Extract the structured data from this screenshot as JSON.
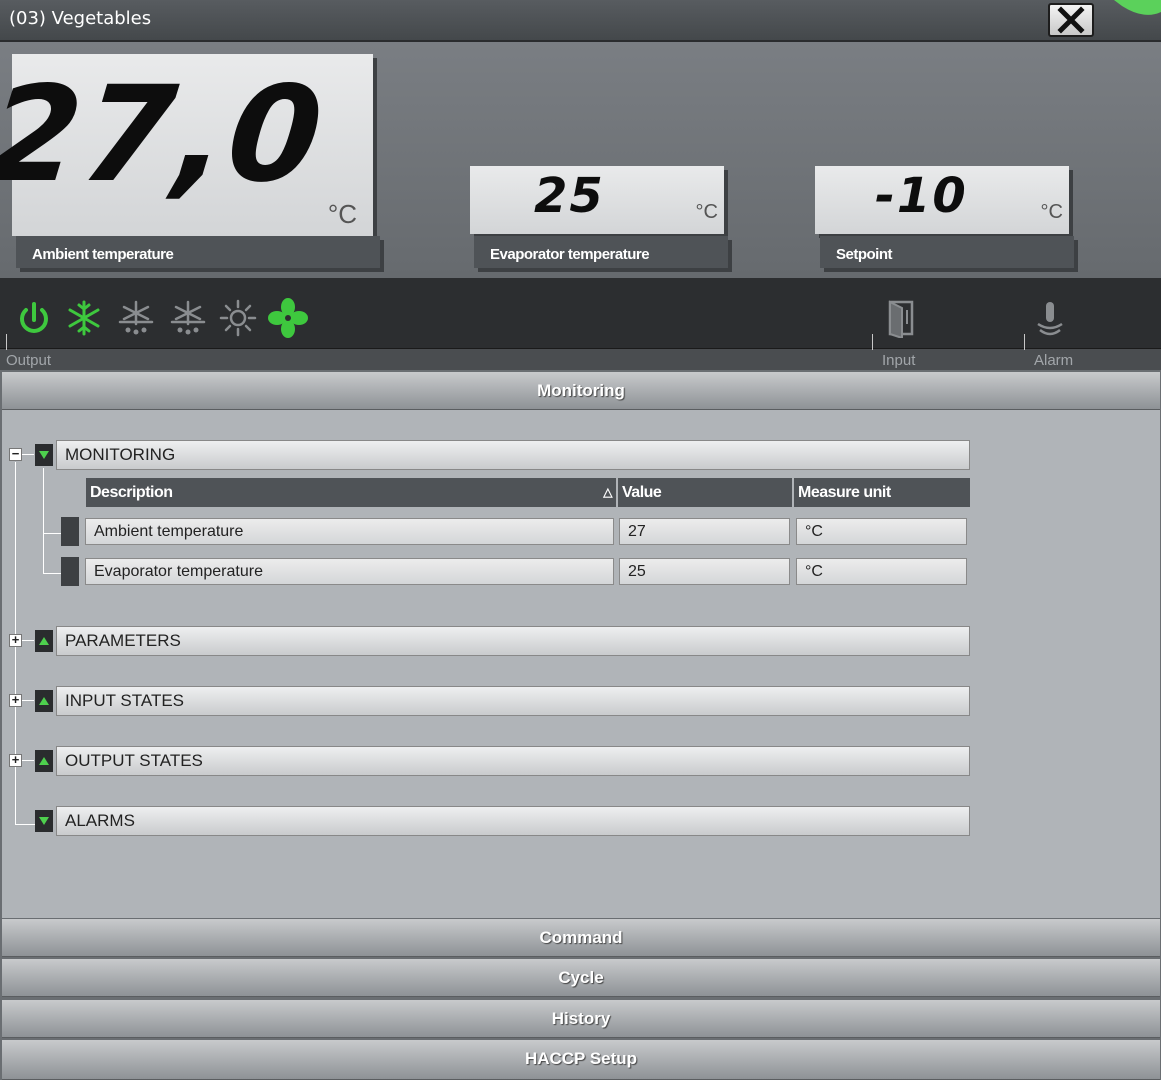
{
  "window": {
    "title": "(03) Vegetables",
    "close_icon": "close-icon"
  },
  "displays": {
    "ambient": {
      "value": "27,0",
      "unit": "°C",
      "label": "Ambient temperature"
    },
    "evaporator": {
      "value": "25",
      "unit": "°C",
      "label": "Evaporator temperature"
    },
    "setpoint": {
      "value": "-10",
      "unit": "°C",
      "label": "Setpoint"
    }
  },
  "status_bar": {
    "output_label": "Output",
    "input_label": "Input",
    "alarm_label": "Alarm",
    "icons": [
      "power-icon",
      "snowflake-icon",
      "defrost-icon",
      "defrost-alt-icon",
      "light-icon",
      "fan-icon",
      "door-icon",
      "alarm-bell-icon"
    ],
    "active_color": "#3ec83e",
    "inactive_color": "#8a8d90"
  },
  "sections": {
    "monitoring": "Monitoring",
    "command": "Command",
    "cycle": "Cycle",
    "history": "History",
    "haccp": "HACCP Setup"
  },
  "tree": {
    "groups": [
      {
        "label": "MONITORING",
        "expanded": true
      },
      {
        "label": "PARAMETERS",
        "expanded": false
      },
      {
        "label": "INPUT STATES",
        "expanded": false
      },
      {
        "label": "OUTPUT STATES",
        "expanded": false
      },
      {
        "label": "ALARMS",
        "expanded": true
      }
    ],
    "table": {
      "columns": [
        "Description",
        "Value",
        "Measure unit"
      ],
      "sort_indicator": "△",
      "rows": [
        {
          "description": "Ambient temperature",
          "value": "27",
          "unit": "°C"
        },
        {
          "description": "Evaporator temperature",
          "value": "25",
          "unit": "°C"
        }
      ]
    },
    "toggle_minus": "−",
    "toggle_plus": "+"
  }
}
